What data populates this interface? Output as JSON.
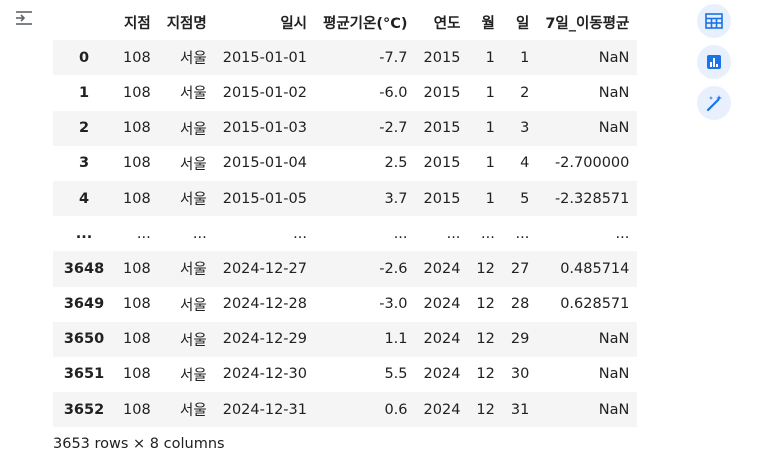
{
  "header": {
    "columns": [
      "",
      "지점",
      "지점명",
      "일시",
      "평균기온(°C)",
      "연도",
      "월",
      "일",
      "7일_이동평균"
    ]
  },
  "rows": [
    {
      "index": "0",
      "cells": [
        "108",
        "서울",
        "2015-01-01",
        "-7.7",
        "2015",
        "1",
        "1",
        "NaN"
      ]
    },
    {
      "index": "1",
      "cells": [
        "108",
        "서울",
        "2015-01-02",
        "-6.0",
        "2015",
        "1",
        "2",
        "NaN"
      ]
    },
    {
      "index": "2",
      "cells": [
        "108",
        "서울",
        "2015-01-03",
        "-2.7",
        "2015",
        "1",
        "3",
        "NaN"
      ]
    },
    {
      "index": "3",
      "cells": [
        "108",
        "서울",
        "2015-01-04",
        "2.5",
        "2015",
        "1",
        "4",
        "-2.700000"
      ]
    },
    {
      "index": "4",
      "cells": [
        "108",
        "서울",
        "2015-01-05",
        "3.7",
        "2015",
        "1",
        "5",
        "-2.328571"
      ]
    },
    {
      "index": "...",
      "cells": [
        "...",
        "...",
        "...",
        "...",
        "...",
        "...",
        "...",
        "..."
      ]
    },
    {
      "index": "3648",
      "cells": [
        "108",
        "서울",
        "2024-12-27",
        "-2.6",
        "2024",
        "12",
        "27",
        "0.485714"
      ]
    },
    {
      "index": "3649",
      "cells": [
        "108",
        "서울",
        "2024-12-28",
        "-3.0",
        "2024",
        "12",
        "28",
        "0.628571"
      ]
    },
    {
      "index": "3650",
      "cells": [
        "108",
        "서울",
        "2024-12-29",
        "1.1",
        "2024",
        "12",
        "29",
        "NaN"
      ]
    },
    {
      "index": "3651",
      "cells": [
        "108",
        "서울",
        "2024-12-30",
        "5.5",
        "2024",
        "12",
        "30",
        "NaN"
      ]
    },
    {
      "index": "3652",
      "cells": [
        "108",
        "서울",
        "2024-12-31",
        "0.6",
        "2024",
        "12",
        "31",
        "NaN"
      ]
    }
  ],
  "shape_note": "3653 rows × 8 columns",
  "side_buttons": [
    {
      "icon": "table-icon"
    },
    {
      "icon": "chart-icon"
    },
    {
      "icon": "magic-wand-icon"
    }
  ],
  "colors": {
    "accent": "#1a73e8",
    "button_bg": "#e8f0fe",
    "stripe": "#f5f5f5"
  }
}
